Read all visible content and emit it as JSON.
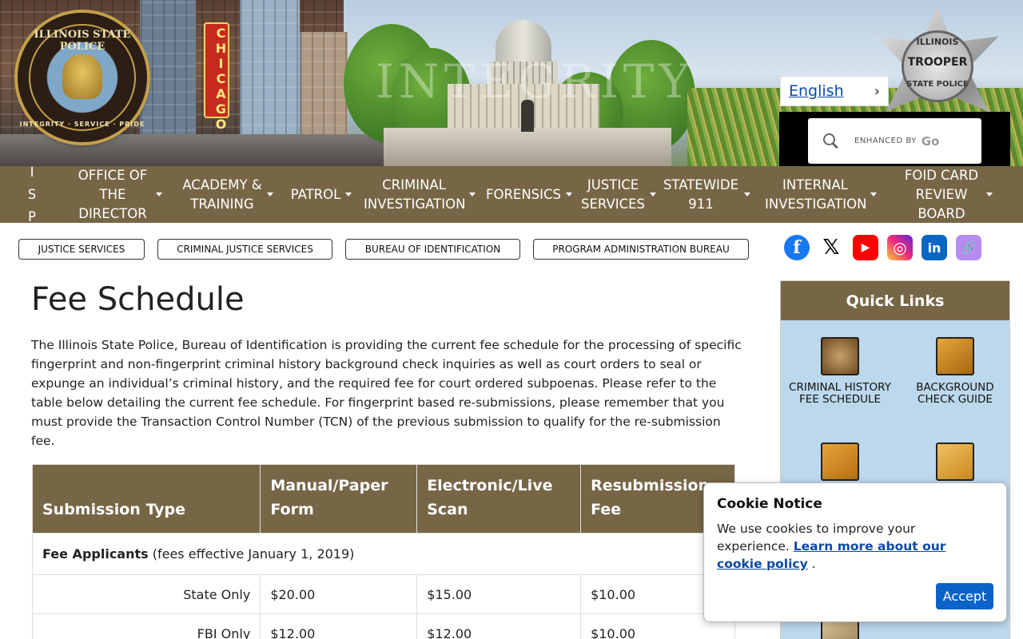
{
  "banner": {
    "seal_top": "ILLINOIS STATE POLICE",
    "seal_bottom": "INTEGRITY · SERVICE · PRIDE",
    "chicago_sign": "CHICAGO",
    "watermark": "INTEGRITY",
    "badge_line1": "ILLINOIS",
    "badge_line2": "TROOPER",
    "badge_line3": "STATE POLICE"
  },
  "language": {
    "label": "English",
    "chevron": "›"
  },
  "search": {
    "enhanced_by": "ENHANCED BY",
    "brand": "Go"
  },
  "nav": [
    {
      "label": "I S P",
      "caret": false
    },
    {
      "label": "OFFICE OF THE DIRECTOR",
      "caret": true
    },
    {
      "label": "ACADEMY & TRAINING",
      "caret": true
    },
    {
      "label": "PATROL",
      "caret": true
    },
    {
      "label": "CRIMINAL INVESTIGATION",
      "caret": true
    },
    {
      "label": "FORENSICS",
      "caret": true
    },
    {
      "label": "JUSTICE SERVICES",
      "caret": true
    },
    {
      "label": "STATEWIDE 911",
      "caret": true
    },
    {
      "label": "INTERNAL INVESTIGATION",
      "caret": true
    },
    {
      "label": "FOID CARD REVIEW BOARD",
      "caret": true
    }
  ],
  "breadcrumbs": [
    "JUSTICE SERVICES",
    "CRIMINAL JUSTICE SERVICES",
    "BUREAU OF IDENTIFICATION",
    "PROGRAM ADMINISTRATION BUREAU"
  ],
  "social": [
    {
      "name": "facebook-icon",
      "glyph": "f",
      "color": "#1877f2"
    },
    {
      "name": "x-icon",
      "glyph": "𝕏",
      "color": "#000000"
    },
    {
      "name": "youtube-icon",
      "glyph": "▶",
      "color": "#ff0000"
    },
    {
      "name": "instagram-icon",
      "glyph": "◎",
      "color": "#d6249f"
    },
    {
      "name": "linkedin-icon",
      "glyph": "in",
      "color": "#0a66c2"
    },
    {
      "name": "link-icon",
      "glyph": "🔗",
      "color": "#b68cf0"
    }
  ],
  "main": {
    "title": "Fee Schedule",
    "intro": "The Illinois State Police, Bureau of Identification is providing the current fee schedule for the processing of specific fingerprint and non-fingerprint criminal history background check inquiries as well as court orders to seal or expunge an individual’s criminal history, and the required fee for court ordered subpoenas. Please refer to the table below detailing the current fee schedule. For fingerprint based re-submissions, please remember that you must provide the Transaction Control Number (TCN) of the previous submission to qualify for the re-submission fee."
  },
  "table": {
    "headers": [
      "Submission Type",
      "Manual/Paper Form",
      "Electronic/Live Scan",
      "Resubmission Fee"
    ],
    "group_label": "Fee Applicants",
    "group_note": " (fees effective January 1, 2019)",
    "rows": [
      [
        "State Only",
        "$20.00",
        "$15.00",
        "$10.00"
      ],
      [
        "FBI Only",
        "$12.00",
        "$12.00",
        "$10.00"
      ]
    ]
  },
  "quick_links": {
    "title": "Quick Links",
    "items": [
      "CRIMINAL HISTORY FEE SCHEDULE",
      "BACKGROUND CHECK GUIDE"
    ]
  },
  "cookie": {
    "title": "Cookie Notice",
    "text": "We use cookies to improve your experience.",
    "link": "Learn more about our cookie policy",
    "period": ".",
    "accept": "Accept"
  }
}
